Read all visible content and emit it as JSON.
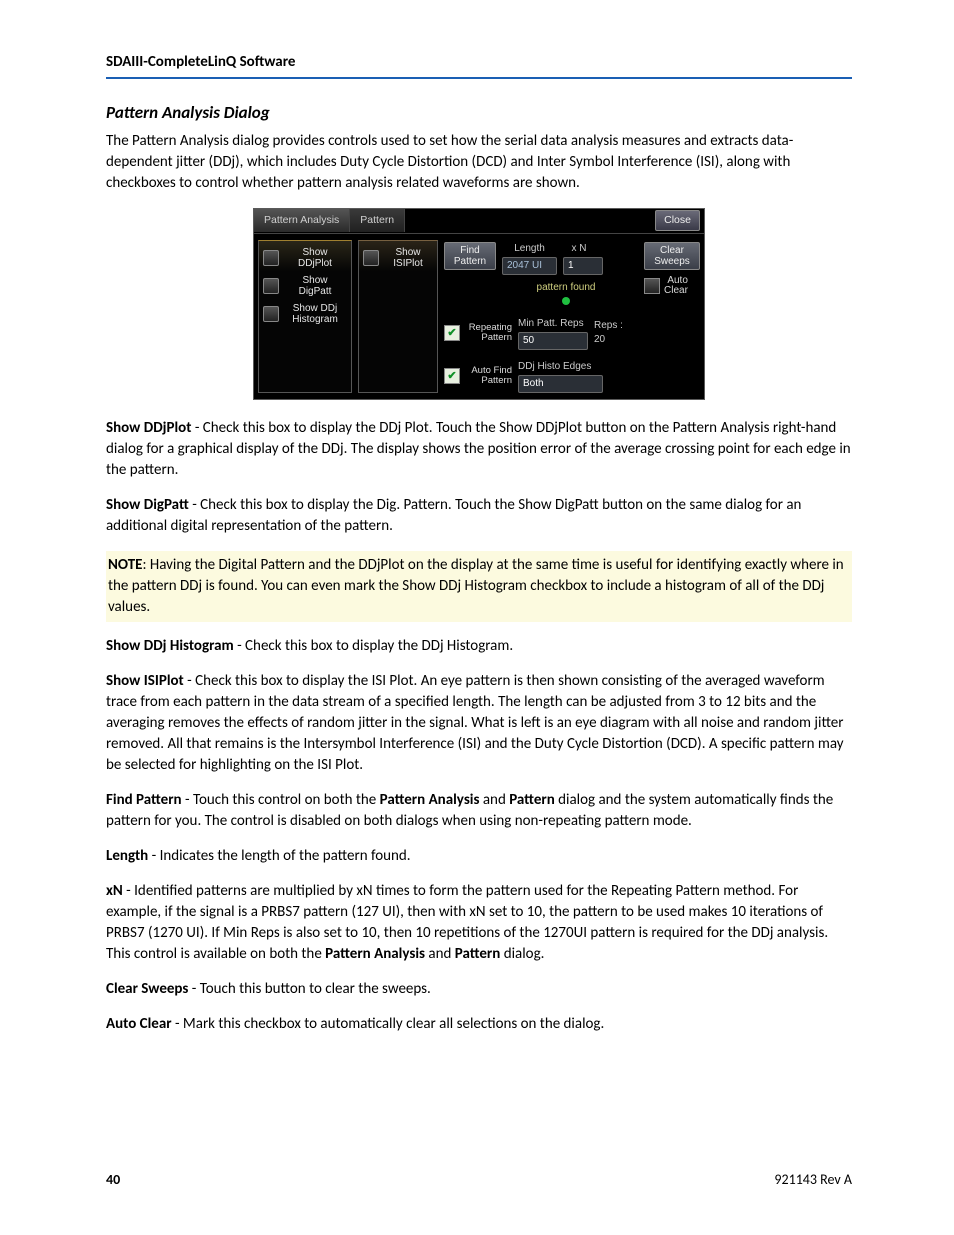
{
  "header": "SDAIII-CompleteLinQ Software",
  "title": "Pattern Analysis Dialog",
  "intro": "The Pattern Analysis dialog provides controls used to set how the serial data analysis measures and extracts data-dependent jitter (DDj), which includes Duty Cycle Distortion (DCD) and Inter Symbol Interference (ISI), along with checkboxes to control whether pattern analysis related waveforms are shown.",
  "dialog": {
    "tab1": "Pattern Analysis",
    "tab2": "Pattern",
    "close": "Close",
    "show_ddjplot": "Show\nDDjPlot",
    "show_digpatt": "Show\nDigPatt",
    "show_ddjhist": "Show DDj\nHistogram",
    "show_isiplot": "Show\nISIPlot",
    "find_pattern": "Find\nPattern",
    "length_label": "Length",
    "length_val": "2047 UI",
    "xn_label": "x N",
    "xn_val": "1",
    "status": "pattern found",
    "repeating": "Repeating\nPattern",
    "minpatt_label": "Min Patt. Reps",
    "minpatt_val": "50",
    "reps_label": "Reps :",
    "reps_val": "20",
    "autofind": "Auto Find\nPattern",
    "histo_label": "DDj Histo Edges",
    "histo_val": "Both",
    "clear_sweeps": "Clear\nSweeps",
    "auto_clear": "Auto\nClear"
  },
  "p_ddjplot_b": "Show DDjPlot",
  "p_ddjplot": " - Check this box to display the DDj Plot. Touch the Show DDjPlot button on the Pattern Analysis right-hand dialog for a graphical display of the DDj. The display shows the position error of the average crossing point for each edge in the pattern.",
  "p_digpatt_b": "Show DigPatt",
  "p_digpatt": " - Check this box to display the Dig. Pattern. Touch the Show DigPatt button on the same dialog for an additional digital representation of the pattern.",
  "note_b": "NOTE",
  "note": ": Having the Digital Pattern and the DDjPlot on the display at the same time is useful for identifying exactly where in the pattern DDj is found. You can even mark the Show DDj Histogram checkbox to include a histogram of all of the DDj values.",
  "p_ddjhist_b": "Show DDj Histogram",
  "p_ddjhist": " - Check this box to display the DDj Histogram.",
  "p_isiplot_b": "Show ISIPlot",
  "p_isiplot": " - Check this box to display the ISI Plot. An eye pattern is then shown consisting of the averaged waveform trace from each pattern in the data stream of a specified length. The length can be adjusted from 3 to 12 bits and the averaging removes the effects of random jitter in the signal. What is left is an eye diagram with all noise and random jitter removed. All that remains is the Intersymbol Interference (ISI) and the Duty Cycle Distortion (DCD). A specific pattern may be selected for highlighting on the ISI Plot.",
  "p_findpat_b": "Find Pattern",
  "p_findpat_1": " - Touch this control on both the ",
  "p_findpat_b2": "Pattern Analysis",
  "p_findpat_2": " and ",
  "p_findpat_b3": "Pattern",
  "p_findpat_3": " dialog and the system automatically finds the pattern for you. The control is disabled on both dialogs when using non-repeating pattern mode.",
  "p_length_b": "Length",
  "p_length": " - Indicates the length of the pattern found.",
  "p_xn_b": "xN",
  "p_xn_1": " - Identified patterns are multiplied by xN times to form the pattern used for the Repeating Pattern method. For example, if the signal is a PRBS7 pattern (127 UI), then with xN set to 10, the pattern to be used makes 10 iterations of PRBS7 (1270 UI). If Min Reps is also set to 10, then 10 repetitions of the 1270UI pattern is required for the DDj analysis. This control is available on both the ",
  "p_xn_b2": "Pattern Analysis",
  "p_xn_2": " and ",
  "p_xn_b3": "Pattern",
  "p_xn_3": " dialog.",
  "p_clear_b": "Clear Sweeps",
  "p_clear": " - Touch this button to clear the sweeps.",
  "p_autoclear_b": "Auto Clear",
  "p_autoclear": " - Mark this checkbox to automatically clear all selections on the dialog.",
  "page_num": "40",
  "doc_rev": "921143 Rev A"
}
